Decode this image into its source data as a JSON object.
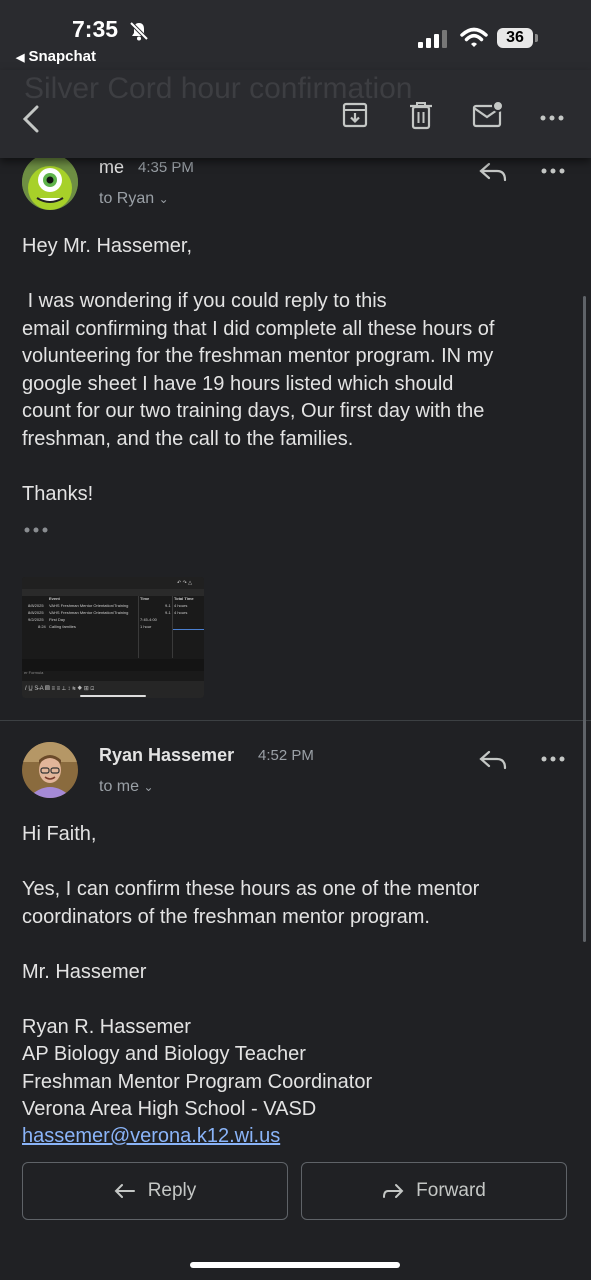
{
  "status_bar": {
    "time": "7:35",
    "back_app": "Snapchat",
    "battery": "36"
  },
  "toolbar": {
    "title_ghost": "Silver Cord hour confirmation"
  },
  "messages": [
    {
      "sender": "me",
      "time": "4:35 PM",
      "recipient": "to Ryan",
      "body": "Hey Mr. Hassemer,\n\n I was wondering if you could reply to this\nemail confirming that I did complete all these hours of\nvolunteering for the freshman mentor program. IN my\ngoogle sheet I have 19 hours listed which should\ncount for our two training days, Our first day with the\nfreshman, and the call to the families.\n\nThanks!",
      "attachment": {
        "columns": [
          "Event",
          "Time",
          "Total Time"
        ],
        "rows": [
          [
            "8/8/2025",
            "VAHS Freshman Mentor Orientation/Training",
            "9-1",
            "4 hours"
          ],
          [
            "8/8/2025",
            "VAHS Freshman Mentor Orientation/Training",
            "9-1",
            "4 hours"
          ],
          [
            "9/2/2025",
            "First Day",
            "7:45-4:00",
            ""
          ],
          [
            "8:24",
            "Calling families",
            "1 hour",
            ""
          ]
        ],
        "formula_placeholder": "er Formula"
      }
    },
    {
      "sender": "Ryan Hassemer",
      "time": "4:52 PM",
      "recipient": "to me",
      "body": "Hi Faith,\n\nYes, I can confirm these hours as one of the mentor\ncoordinators of the freshman mentor program.\n\nMr. Hassemer\n\nRyan R. Hassemer\nAP Biology and Biology Teacher\nFreshman Mentor Program Coordinator\nVerona Area High School - VASD",
      "email_link": "hassemer@verona.k12.wi.us"
    }
  ],
  "actions": {
    "reply": "Reply",
    "forward": "Forward"
  }
}
